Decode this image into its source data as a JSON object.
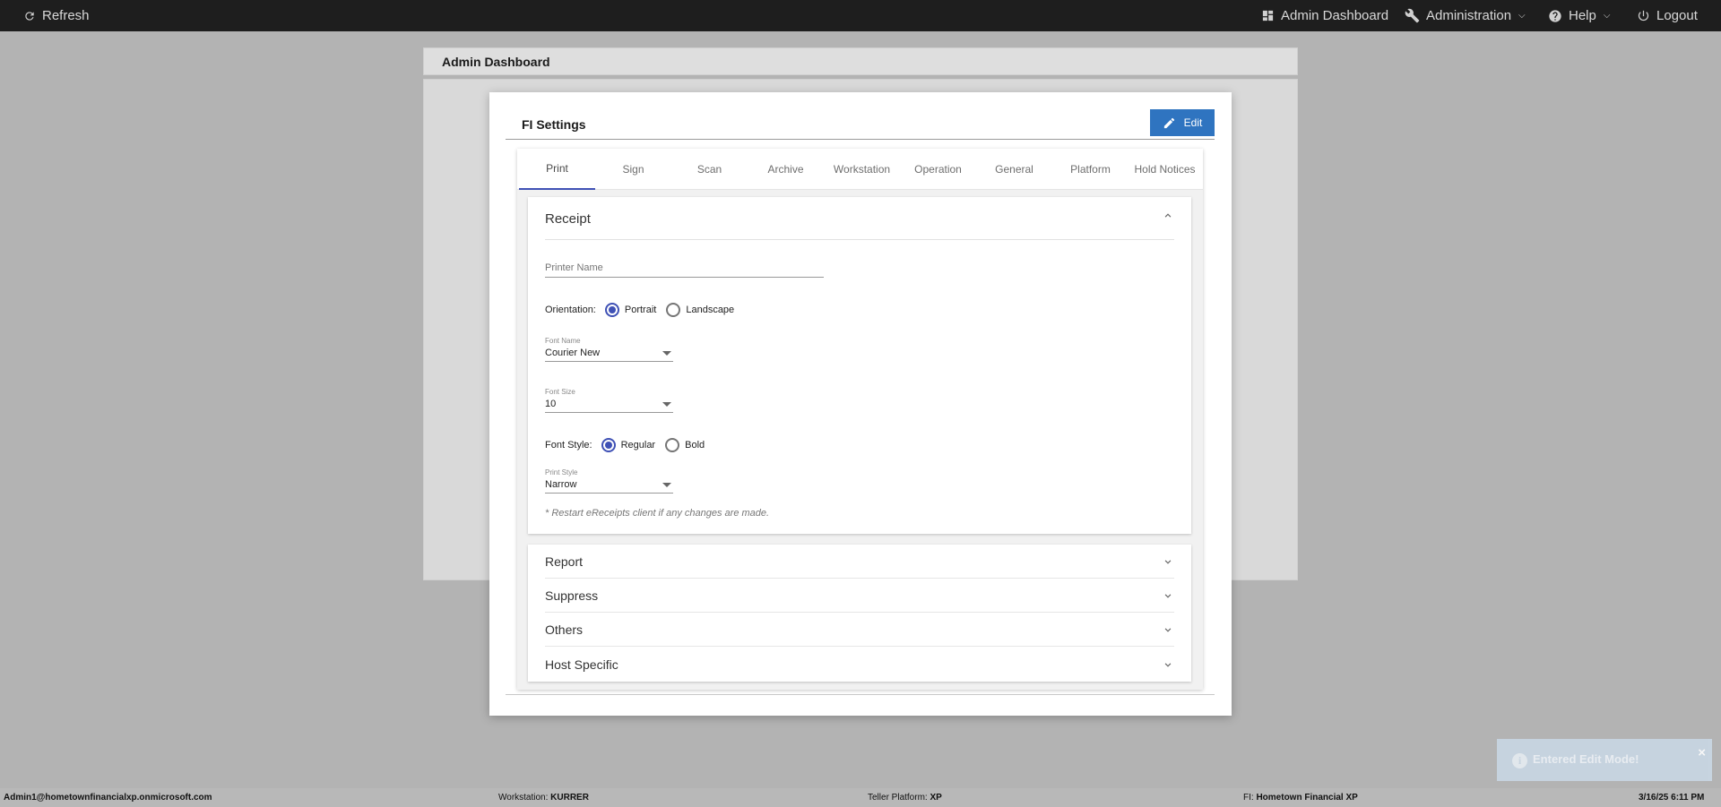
{
  "topbar": {
    "refresh_label": "Refresh",
    "admin_dashboard_label": "Admin Dashboard",
    "administration_label": "Administration",
    "help_label": "Help",
    "logout_label": "Logout"
  },
  "background": {
    "header_title": "Admin Dashboard"
  },
  "modal": {
    "title": "FI Settings",
    "edit_label": "Edit",
    "tabs": [
      {
        "label": "Print",
        "active": true
      },
      {
        "label": "Sign"
      },
      {
        "label": "Scan"
      },
      {
        "label": "Archive"
      },
      {
        "label": "Workstation"
      },
      {
        "label": "Operation"
      },
      {
        "label": "General"
      },
      {
        "label": "Platform"
      },
      {
        "label": "Hold Notices"
      }
    ],
    "receipt": {
      "title": "Receipt",
      "printer_name_placeholder": "Printer Name",
      "orientation_label": "Orientation:",
      "orientation_options": [
        "Portrait",
        "Landscape"
      ],
      "orientation_selected": "Portrait",
      "font_name_label": "Font Name",
      "font_name_value": "Courier New",
      "font_size_label": "Font Size",
      "font_size_value": "10",
      "font_style_label": "Font Style:",
      "font_style_options": [
        "Regular",
        "Bold"
      ],
      "font_style_selected": "Regular",
      "print_style_label": "Print Style",
      "print_style_value": "Narrow",
      "note": "* Restart eReceipts client if any changes are made."
    },
    "sections": [
      "Report",
      "Suppress",
      "Others",
      "Host Specific"
    ]
  },
  "toast": {
    "message": "Entered Edit Mode!",
    "close": "×"
  },
  "statusbar": {
    "user": "Admin1@hometownfinancialxp.onmicrosoft.com",
    "workstation_label": "Workstation:",
    "workstation_value": "KURRER",
    "teller_platform_label": "Teller Platform:",
    "teller_platform_value": "XP",
    "fi_label": "FI:",
    "fi_value": "Hometown Financial XP",
    "datetime": "3/16/25 6:11 PM"
  },
  "colors": {
    "topbar": "#1e1e1e",
    "accent": "#3f51b5",
    "edit_button": "#2f74c0",
    "overlay": "#b3b3b3"
  }
}
